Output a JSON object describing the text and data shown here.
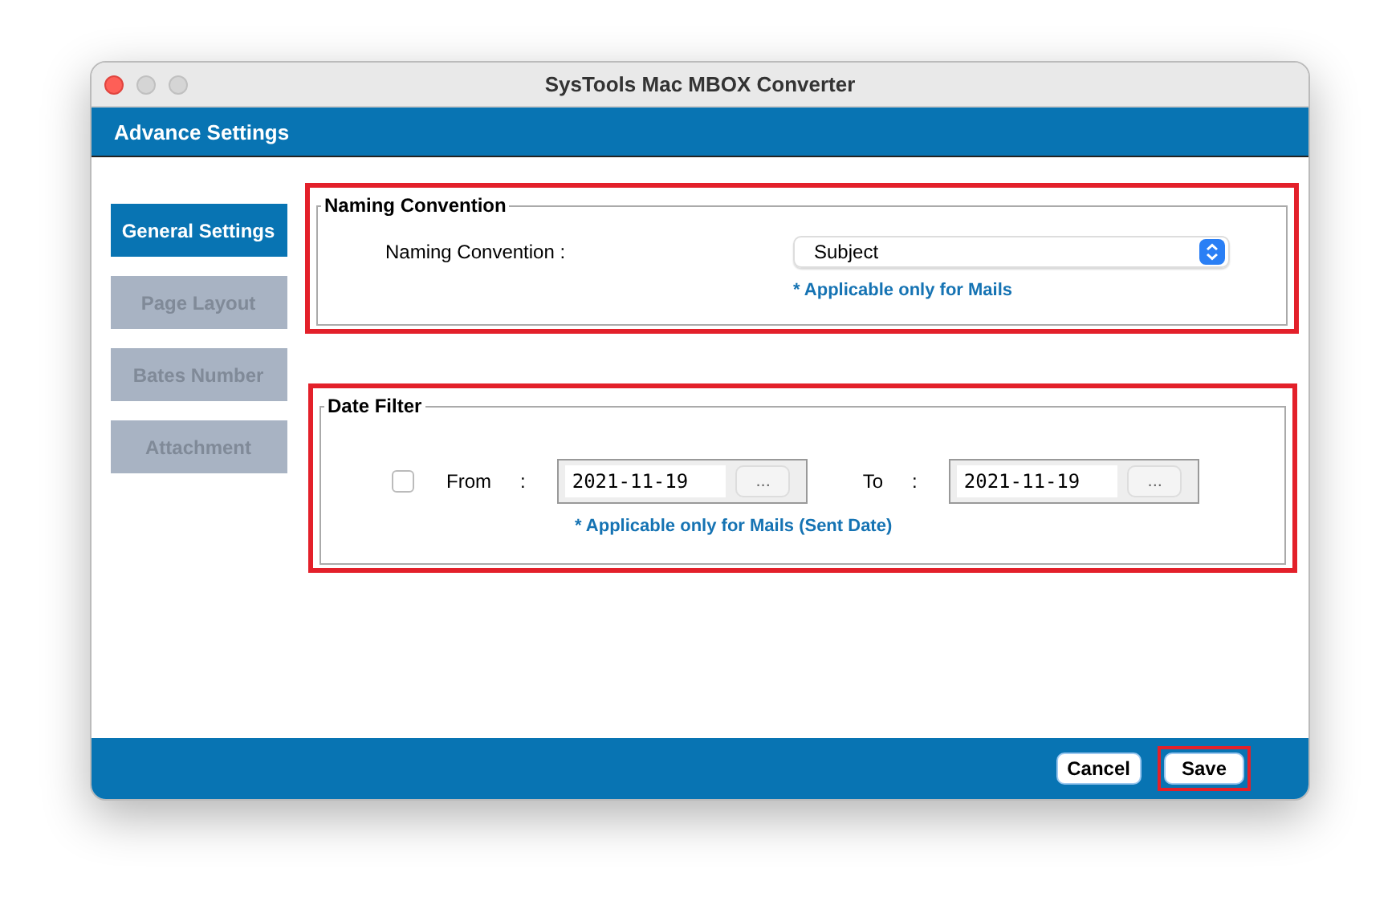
{
  "window": {
    "title": "SysTools Mac MBOX Converter"
  },
  "header": {
    "title": "Advance Settings"
  },
  "sidebar": {
    "items": [
      {
        "label": "General Settings",
        "selected": true
      },
      {
        "label": "Page Layout",
        "selected": false
      },
      {
        "label": "Bates Number",
        "selected": false
      },
      {
        "label": "Attachment",
        "selected": false
      }
    ]
  },
  "naming_convention": {
    "legend": "Naming Convention",
    "label": "Naming Convention :",
    "dropdown": {
      "value": "Subject"
    },
    "note": "* Applicable only for Mails",
    "highlighted": true
  },
  "date_filter": {
    "legend": "Date Filter",
    "checked": false,
    "from_label": "From",
    "from_colon": ":",
    "from_value": "2021-11-19",
    "from_button": "...",
    "to_label": "To",
    "to_colon": ":",
    "to_value": "2021-11-19",
    "to_button": "...",
    "note": "* Applicable only for Mails (Sent Date)",
    "highlighted": true
  },
  "footer": {
    "buttons": [
      {
        "label": "Cancel",
        "highlighted": false
      },
      {
        "label": "Save",
        "highlighted": true
      }
    ]
  }
}
